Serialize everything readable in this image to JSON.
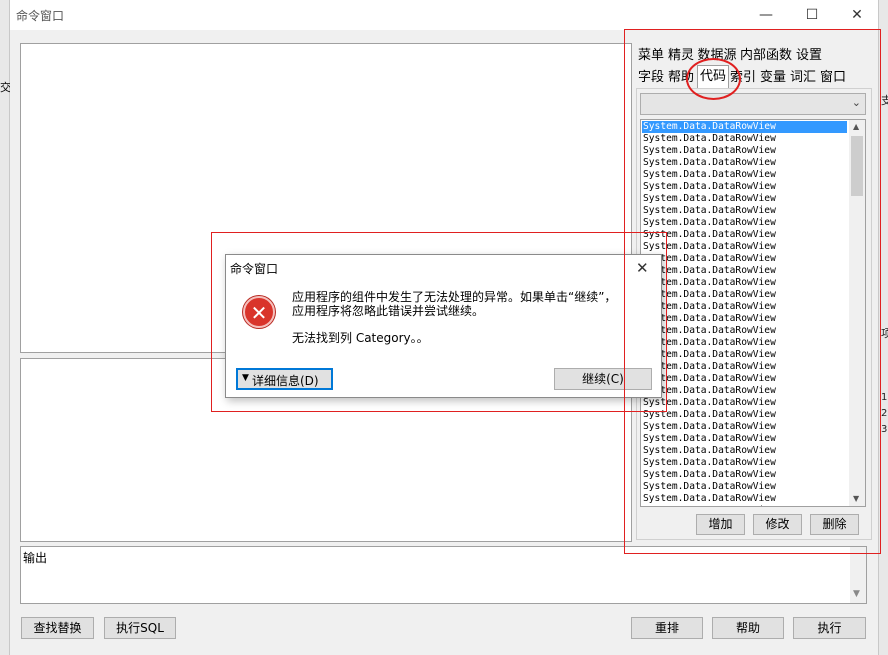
{
  "window": {
    "title": "命令窗口",
    "min": "—",
    "max": "☐",
    "close": "✕"
  },
  "output": {
    "label": "输出"
  },
  "bottom_buttons": {
    "find_replace": "查找替换",
    "exec_sql": "执行SQL",
    "rearrange": "重排",
    "help": "帮助",
    "execute": "执行"
  },
  "panel": {
    "tabs_row1": [
      "菜单",
      "精灵",
      "数据源",
      "内部函数",
      "设置"
    ],
    "tabs_row2": [
      "字段",
      "帮助",
      "代码",
      "索引",
      "变量",
      "词汇",
      "窗口"
    ],
    "active_tab": "代码",
    "list_items": [
      "System.Data.DataRowView",
      "System.Data.DataRowView",
      "System.Data.DataRowView",
      "System.Data.DataRowView",
      "System.Data.DataRowView",
      "System.Data.DataRowView",
      "System.Data.DataRowView",
      "System.Data.DataRowView",
      "System.Data.DataRowView",
      "System.Data.DataRowView",
      "System.Data.DataRowView",
      "System.Data.DataRowView",
      "System.Data.DataRowView",
      "System.Data.DataRowView",
      "System.Data.DataRowView",
      "System.Data.DataRowView",
      "System.Data.DataRowView",
      "System.Data.DataRowView",
      "System.Data.DataRowView",
      "System.Data.DataRowView",
      "System.Data.DataRowView",
      "System.Data.DataRowView",
      "System.Data.DataRowView",
      "System.Data.DataRowView",
      "System.Data.DataRowView",
      "System.Data.DataRowView",
      "System.Data.DataRowView",
      "System.Data.DataRowView",
      "System.Data.DataRowView",
      "System.Data.DataRowView",
      "System.Data.DataRowView",
      "System.Data.DataRowView",
      "System.Data.DataRowView"
    ],
    "add": "增加",
    "modify": "修改",
    "delete": "删除"
  },
  "dialog": {
    "title": "命令窗口",
    "message_line1": "应用程序的组件中发生了无法处理的异常。如果单击“继续”，",
    "message_line2": "应用程序将忽略此错误并尝试继续。",
    "message_detail": "无法找到列 Category。。",
    "details_button": "详细信息(D)",
    "continue_button": "继续(C)"
  },
  "right_strip": {
    "rows": [
      "支",
      "项",
      "1",
      "2",
      "3"
    ]
  },
  "left_strip": {
    "char": "交"
  },
  "colors": {
    "annotation_red": "#e02020",
    "selection_blue": "#3399ff",
    "error_red": "#d9342b"
  }
}
